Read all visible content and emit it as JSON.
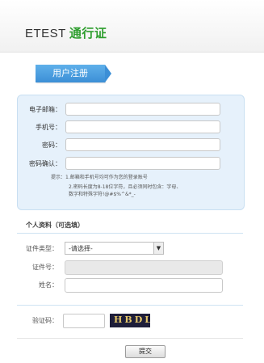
{
  "header": {
    "brand": "ETEST",
    "brand_sub": "通行证"
  },
  "tab": {
    "label": "用户注册"
  },
  "account": {
    "email_label": "电子邮箱：",
    "phone_label": "手机号：",
    "password_label": "密码：",
    "confirm_label": "密码确认：",
    "email_value": "",
    "phone_value": "",
    "password_value": "",
    "confirm_value": "",
    "hint_1": "提示：1.邮箱和手机号均可作为您的登录账号",
    "hint_2": "2.密码长度为8-18位字符，且必须同时包含：字母、",
    "hint_3": "数字和特殊字符!@#$%^&*_-"
  },
  "profile": {
    "title": "个人资料（可选填）",
    "id_type_label": "证件类型：",
    "id_type_selected": "-请选择-",
    "id_number_label": "证件号：",
    "name_label": "姓名："
  },
  "verify": {
    "label": "验证码：",
    "captcha_text": "HBDL"
  },
  "actions": {
    "submit_label": "提交"
  },
  "colors": {
    "accent_blue": "#3c8fd6",
    "brand_green": "#2e9e2e",
    "panel_bg": "#e6f1fb"
  }
}
